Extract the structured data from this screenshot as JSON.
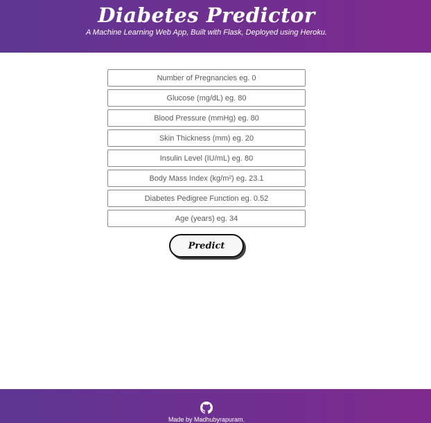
{
  "header": {
    "title": "Diabetes Predictor",
    "subtitle": "A Machine Learning Web App, Built with Flask, Deployed using Heroku."
  },
  "form": {
    "fields": [
      {
        "placeholder": "Number of Pregnancies eg. 0",
        "value": ""
      },
      {
        "placeholder": "Glucose (mg/dL) eg. 80",
        "value": ""
      },
      {
        "placeholder": "Blood Pressure (mmHg) eg. 80",
        "value": ""
      },
      {
        "placeholder": "Skin Thickness (mm) eg. 20",
        "value": ""
      },
      {
        "placeholder": "Insulin Level (IU/mL) eg. 80",
        "value": ""
      },
      {
        "placeholder": "Body Mass Index (kg/m²) eg. 23.1",
        "value": ""
      },
      {
        "placeholder": "Diabetes Pedigree Function eg. 0.52",
        "value": ""
      },
      {
        "placeholder": "Age (years) eg. 34",
        "value": ""
      }
    ],
    "submit_label": "Predict"
  },
  "footer": {
    "icon": "github-icon",
    "credit": "Made by Madhubyrapuram."
  },
  "colors": {
    "header_gradient_start": "#5e3793",
    "header_gradient_end": "#7f2a8e",
    "text_on_header": "#ffffff",
    "field_border": "#8a8a8a"
  }
}
